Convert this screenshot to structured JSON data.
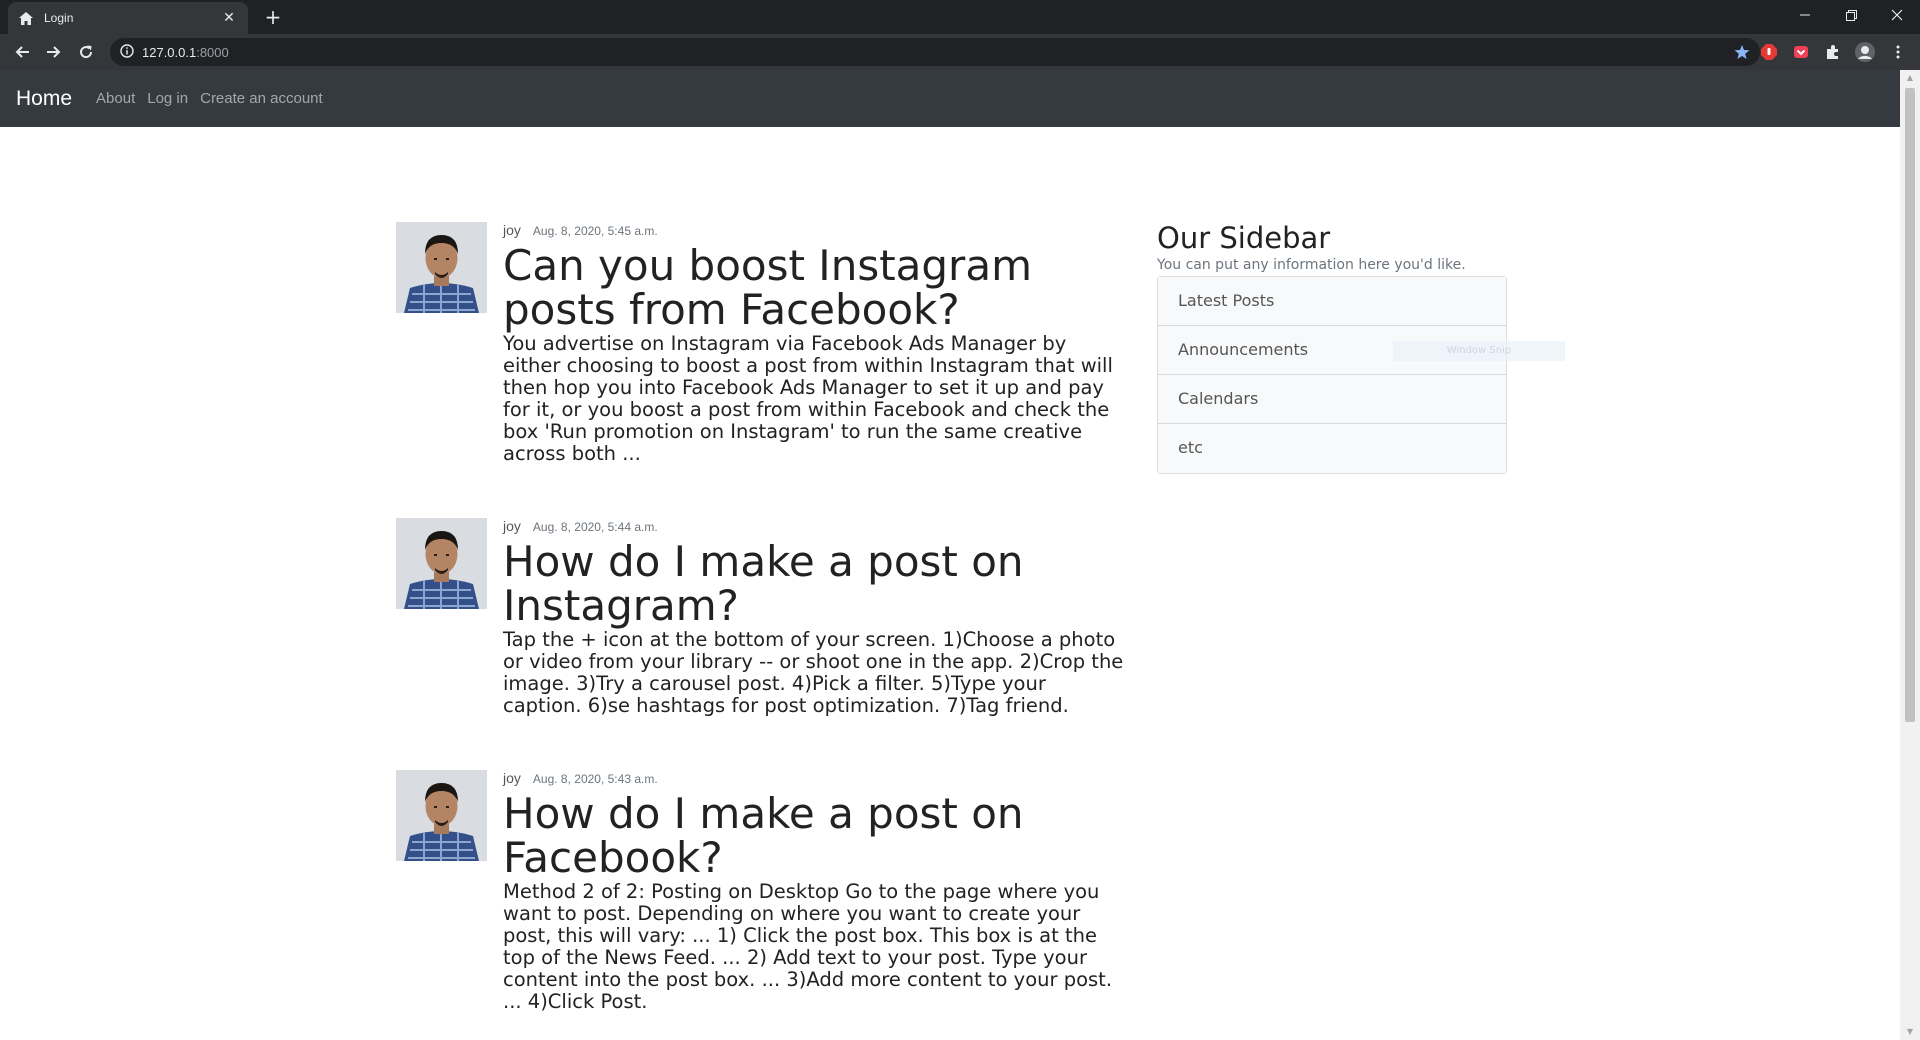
{
  "browser": {
    "tab_title": "Login",
    "url_host": "127.0.0.1",
    "url_port": ":8000"
  },
  "navbar": {
    "brand": "Home",
    "links": [
      "About",
      "Log in",
      "Create an account"
    ]
  },
  "posts": [
    {
      "author": "joy",
      "date": "Aug. 8, 2020, 5:45 a.m.",
      "title": "Can you boost Instagram posts from Facebook?",
      "content": "You advertise on Instagram via Facebook Ads Manager by either choosing to boost a post from within Instagram that will then hop you into Facebook Ads Manager to set it up and pay for it, or you boost a post from within Facebook and check the box 'Run promotion on Instagram' to run the same creative across both ..."
    },
    {
      "author": "joy",
      "date": "Aug. 8, 2020, 5:44 a.m.",
      "title": "How do I make a post on Instagram?",
      "content": "Tap the + icon at the bottom of your screen. 1)Choose a photo or video from your library -- or shoot one in the app. 2)Crop the image. 3)Try a carousel post. 4)Pick a filter. 5)Type your caption. 6)se hashtags for post optimization. 7)Tag friend."
    },
    {
      "author": "joy",
      "date": "Aug. 8, 2020, 5:43 a.m.",
      "title": "How do I make a post on Facebook?",
      "content": "Method 2 of 2: Posting on Desktop Go to the page where you want to post. Depending on where you want to create your post, this will vary: ... 1) Click the post box. This box is at the top of the News Feed. ... 2) Add text to your post. Type your content into the post box. ... 3)Add more content to your post. ... 4)Click Post."
    }
  ],
  "sidebar": {
    "title": "Our Sidebar",
    "subtitle": "You can put any information here you'd like.",
    "items": [
      "Latest Posts",
      "Announcements",
      "Calendars",
      "etc"
    ]
  },
  "overlay": {
    "snip_label": "Window Snip"
  },
  "colors": {
    "navbar_bg": "#343a40",
    "chrome_bg": "#202124",
    "toolbar_bg": "#35363a",
    "bookmark_star": "#8ab4f8"
  }
}
